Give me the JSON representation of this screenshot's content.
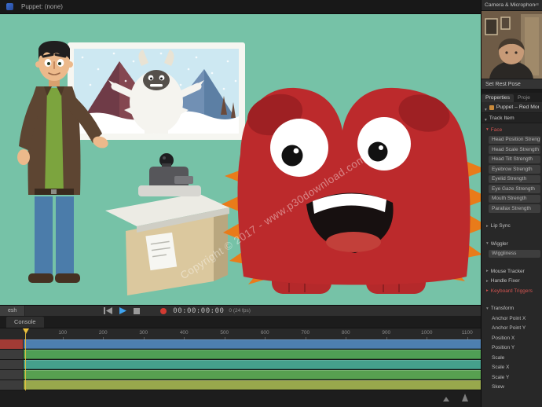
{
  "topbar": {
    "puppet_label": "Puppet: (none)"
  },
  "camera_panel": {
    "title": "Camera & Microphone",
    "rest_pose_label": "Set Rest Pose"
  },
  "right_tabs": {
    "properties_label": "Properties",
    "project_label": "Proje"
  },
  "properties_panel": {
    "puppet_title": "Puppet – Red Mon",
    "track_item_label": "Track Item",
    "items": [
      {
        "label": "Face",
        "cls": "section open red"
      },
      {
        "label": "Head Position Strength",
        "cls": "param"
      },
      {
        "label": "Head Scale Strength",
        "cls": "param"
      },
      {
        "label": "Head Tilt Strength",
        "cls": "param"
      },
      {
        "label": "Eyebrow Strength",
        "cls": "param"
      },
      {
        "label": "Eyelid Strength",
        "cls": "param"
      },
      {
        "label": "Eye Gaze Strength",
        "cls": "param"
      },
      {
        "label": "Mouth Strength",
        "cls": "param"
      },
      {
        "label": "Parallax Strength",
        "cls": "param"
      },
      {
        "label": "Lip Sync",
        "cls": "section gap"
      },
      {
        "label": "Wiggler",
        "cls": "section open gap"
      },
      {
        "label": "Wiggliness",
        "cls": "param"
      },
      {
        "label": "Mouse Tracker",
        "cls": "section gap"
      },
      {
        "label": "Handle Fixer",
        "cls": "section"
      },
      {
        "label": "Keyboard Triggers",
        "cls": "section red"
      },
      {
        "label": "Transform",
        "cls": "section open gap"
      },
      {
        "label": "Anchor Point X",
        "cls": "plain"
      },
      {
        "label": "Anchor Point Y",
        "cls": "plain"
      },
      {
        "label": "Position X",
        "cls": "plain"
      },
      {
        "label": "Position Y",
        "cls": "plain"
      },
      {
        "label": "Scale",
        "cls": "plain"
      },
      {
        "label": "Scale X",
        "cls": "plain"
      },
      {
        "label": "Scale Y",
        "cls": "plain"
      },
      {
        "label": "Skew",
        "cls": "plain"
      }
    ]
  },
  "timeline": {
    "left_tab_label": "esh",
    "console_tab_label": "Console",
    "timecode": "00:00:00:00",
    "fps_label": "0 (24 fps)",
    "ruler_numbers": [
      "100",
      "200",
      "300",
      "400",
      "500",
      "600",
      "700",
      "800",
      "900",
      "1000",
      "1100"
    ],
    "tracks": [
      {
        "bar_color": "#4d7fb0",
        "header_color": "#a23b35"
      },
      {
        "bar_color": "#4f9e55",
        "header_color": "#3c3c3c"
      },
      {
        "bar_color": "#45a08c",
        "header_color": "#3c3c3c"
      },
      {
        "bar_color": "#57a050",
        "header_color": "#3c3c3c"
      },
      {
        "bar_color": "#98a84c",
        "header_color": "#3c3c3c"
      }
    ]
  },
  "scene": {
    "watermark_text": "Copyright © 2017 - www.p30download.com"
  },
  "colors": {
    "selection_red": "#d25450",
    "record_red": "#d23b32",
    "play_blue": "#3fa3ef",
    "monster_red": "#bc2a2c",
    "spike_orange": "#e97b1a",
    "playhead_yellow": "#ecc13d",
    "wall_teal": "#76c2a7"
  },
  "icons": {
    "panel_menu": "≡"
  }
}
